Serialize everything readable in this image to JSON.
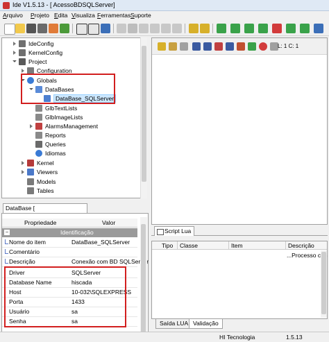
{
  "window": {
    "title": "Ide V1.5.13  - [ AcessoBDSQLServer]"
  },
  "menu": [
    "Arquivo",
    "Projeto",
    "Edita",
    "Visualiza",
    "Ferramentas",
    "Suporte"
  ],
  "toolbar": {
    "icons": [
      "new-icon",
      "open-icon",
      "save-icon",
      "save-all-icon",
      "build-icon",
      "settings-icon",
      "view-tree-icon",
      "view-list-icon",
      "info-icon",
      "copy-icon",
      "cut-icon",
      "paste-icon",
      "undo-icon",
      "redo-icon",
      "delete-icon",
      "connect-icon",
      "connect-b-icon",
      "connect-c-icon",
      "connect-d-icon",
      "connect-e-icon",
      "connect-f-icon",
      "connect-g-icon"
    ]
  },
  "tree": {
    "nodes": [
      {
        "label": "IdeConfig"
      },
      {
        "label": "KernelConfig"
      },
      {
        "label": "Project"
      },
      {
        "label": "Configuration"
      },
      {
        "label": "Globals"
      },
      {
        "label": "DataBases"
      },
      {
        "label": "DataBase_SQLServer"
      },
      {
        "label": "GlbTextLists"
      },
      {
        "label": "GlbImageLists"
      },
      {
        "label": "AlarmsManagement"
      },
      {
        "label": "Reports"
      },
      {
        "label": "Queries"
      },
      {
        "label": "Idiomas"
      },
      {
        "label": "Kernel"
      },
      {
        "label": "Viewers"
      },
      {
        "label": "Models"
      },
      {
        "label": "Tables"
      }
    ]
  },
  "properties": {
    "tab_label": "DataBase [ DataBase_SQLServer ]",
    "col_property": "Propriedade",
    "col_value": "Valor",
    "group": "Identificação",
    "rows": [
      {
        "key": "Nome do item",
        "value": "DataBase_SQLServer"
      },
      {
        "key": "Comentário",
        "value": ""
      },
      {
        "key": "Descrição",
        "value": "Conexão com BD SQLServer"
      },
      {
        "key": "Driver",
        "value": "SQLServer"
      },
      {
        "key": "Database Name",
        "value": "hiscada"
      },
      {
        "key": "Host",
        "value": "10-032\\SQLEXPRESS"
      },
      {
        "key": "Porta",
        "value": "1433"
      },
      {
        "key": "Usuário",
        "value": "sa"
      },
      {
        "key": "Senha",
        "value": "sa"
      }
    ]
  },
  "editor": {
    "line_col": "L: 1 C: 1"
  },
  "script_tab": {
    "label": "Script Lua"
  },
  "messages": {
    "columns": [
      "Tipo",
      "Classe",
      "Item",
      "Descrição"
    ],
    "rows": [
      {
        "tipo": "",
        "classe": "",
        "item": "",
        "descricao": "...Processo con"
      }
    ]
  },
  "bottom_tabs": [
    "Saída LUA",
    "Validação"
  ],
  "status": {
    "company": "HI Tecnologia",
    "version": "1.5.13"
  },
  "colors": {
    "highlight_box": "#d21e1e",
    "selection": "#cde8ff",
    "group_row": "#9a9a9a"
  }
}
